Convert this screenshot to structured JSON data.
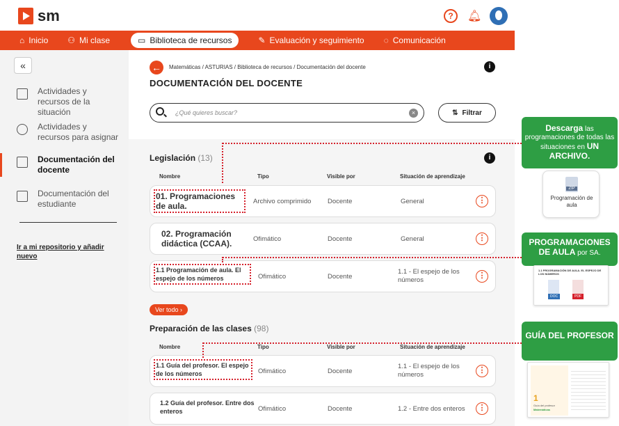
{
  "app": {
    "brand": "sm"
  },
  "nav": [
    {
      "label": "Inicio",
      "icon": "home-icon"
    },
    {
      "label": "Mi clase",
      "icon": "users-icon"
    },
    {
      "label": "Biblioteca de recursos",
      "icon": "folder-icon"
    },
    {
      "label": "Evaluación y seguimiento",
      "icon": "pencil-icon"
    },
    {
      "label": "Comunicación",
      "icon": "chat-icon"
    }
  ],
  "sidebar": {
    "collapse": "«",
    "items": [
      {
        "label": "Actividades y recursos de la situación"
      },
      {
        "label": "Actividades y recursos para asignar"
      },
      {
        "label": "Documentación del docente"
      },
      {
        "label": "Documentación del estudiante"
      }
    ],
    "link": "Ir a mi repositorio y añadir nuevo"
  },
  "breadcrumb": "Matemáticas  /  ASTURIAS  /  Biblioteca de recursos  /  Documentación del docente",
  "page_title": "DOCUMENTACIÓN DEL DOCENTE",
  "search": {
    "placeholder": "¿Qué quieres buscar?",
    "filter_label": "Filtrar"
  },
  "columns": {
    "name": "Nombre",
    "type": "Tipo",
    "visible": "Visible por",
    "situation": "Situación de aprendizaje"
  },
  "legislacion": {
    "title": "Legislación",
    "count": "(13)",
    "rows": [
      {
        "name": "01. Programaciones de aula.",
        "type": "Archivo comprimido",
        "visible": "Docente",
        "situation": "General"
      },
      {
        "name": "02. Programación didáctica (CCAA).",
        "type": "Ofimático",
        "visible": "Docente",
        "situation": "General"
      },
      {
        "name": "1.1 Programación de aula. El espejo de los números",
        "type": "Ofimático",
        "visible": "Docente",
        "situation": "1.1 - El espejo de los números"
      }
    ],
    "ver_todo": "Ver todo ›"
  },
  "preparacion": {
    "title": "Preparación de las clases",
    "count": "(98)",
    "rows": [
      {
        "name": "1.1 Guía del profesor. El espejo de los números",
        "type": "Ofimático",
        "visible": "Docente",
        "situation": "1.1 - El espejo de los números"
      },
      {
        "name": "1.2 Guía del profesor. Entre dos enteros",
        "type": "Ofimático",
        "visible": "Docente",
        "situation": "1.2 - Entre dos enteros"
      }
    ]
  },
  "callouts": {
    "descarga": {
      "strong": "Descarga",
      "rest1": " las programaciones de todas las situaciones en ",
      "strong2": "UN ARCHIVO."
    },
    "programaciones": {
      "strong": "PROGRAMACIONES DE AULA",
      "rest": " por SA."
    },
    "guia": {
      "strong": "GUÍA DEL PROFESOR"
    }
  },
  "cards": {
    "zip_badge": "ZIP",
    "zip_label": "Programación de aula",
    "prog_header": "1.1 PROGRAMACIÓN DE AULA. EL ESPEJO DE LOS NÚMEROS",
    "doc_badge": "DOC",
    "pdf_badge": "PDF",
    "guide_number": "1",
    "guide_subtitle": "Guía del profesor",
    "guide_subject": "Matemáticas"
  },
  "colors": {
    "accent": "#e8471d",
    "green": "#2e9e44",
    "dotted": "#d5202b"
  }
}
